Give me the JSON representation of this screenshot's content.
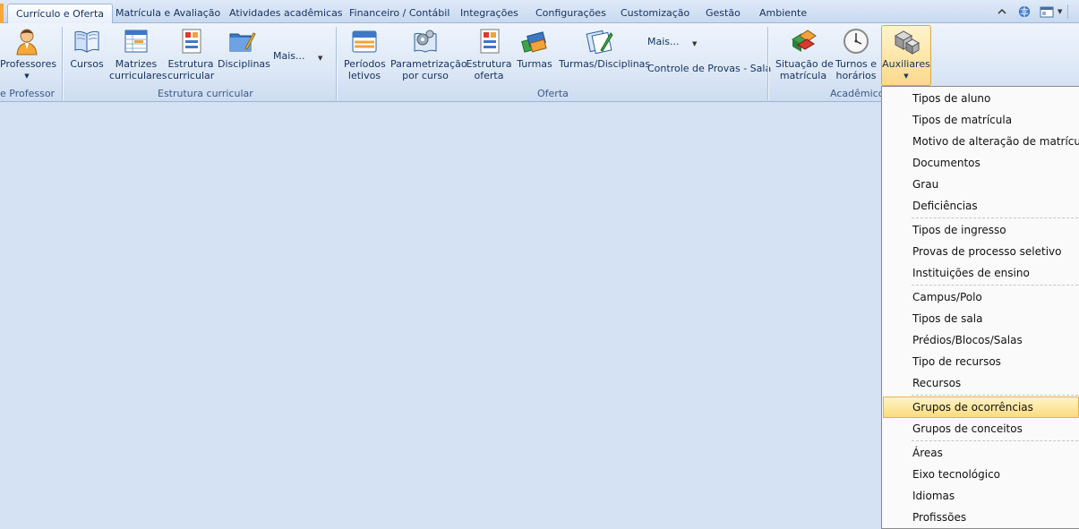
{
  "tabs": {
    "items": [
      "Currículo e Oferta",
      "Matrícula e Avaliação",
      "Atividades acadêmicas",
      "Financeiro / Contábil",
      "Integrações",
      "Configurações",
      "Customização",
      "Gestão",
      "Ambiente"
    ],
    "active": "Currículo e Oferta"
  },
  "ribbon": {
    "professor_group": {
      "label": "e Professor",
      "professores": "Professores"
    },
    "estrutura_group": {
      "label": "Estrutura curricular",
      "cursos": "Cursos",
      "matrizes_1": "Matrizes",
      "matrizes_2": "curriculares",
      "estrutura_1": "Estrutura",
      "estrutura_2": "curricular",
      "disciplinas": "Disciplinas",
      "mais": "Mais..."
    },
    "oferta_group": {
      "label": "Oferta",
      "periodos_1": "Períodos",
      "periodos_2": "letivos",
      "param_1": "Parametrização",
      "param_2": "por curso",
      "estrutura_1": "Estrutura",
      "estrutura_2": "oferta",
      "turmas": "Turmas",
      "turmas_disc": "Turmas/Disciplinas",
      "mais": "Mais...",
      "controle": "Controle de Provas - Sala"
    },
    "academico_group": {
      "label": "Acadêmico",
      "situacao_1": "Situação de",
      "situacao_2": "matrícula",
      "turnos_1": "Turnos e",
      "turnos_2": "horários",
      "auxiliares": "Auxiliares"
    }
  },
  "dropdown_menu": {
    "items": [
      "Tipos de aluno",
      "Tipos de matrícula",
      "Motivo de alteração de matrícula",
      "Documentos",
      "Grau",
      "Deficiências",
      "Tipos de ingresso",
      "Provas de processo seletivo",
      "Instituições de ensino",
      "Campus/Polo",
      "Tipos de sala",
      "Prédios/Blocos/Salas",
      "Tipo de recursos",
      "Recursos",
      "Grupos de ocorrências",
      "Grupos de conceitos",
      "Áreas",
      "Eixo tecnológico",
      "Idiomas",
      "Profissões"
    ],
    "highlighted": "Grupos de ocorrências"
  },
  "colors": {
    "background": "#d5e2f3",
    "highlight": "#fbdc7e",
    "accent_orange": "#f7a839"
  }
}
